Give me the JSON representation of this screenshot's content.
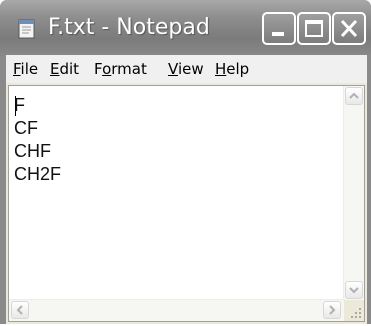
{
  "window": {
    "title": "F.txt - Notepad",
    "icon": "notepad-icon",
    "controls": {
      "minimize_icon": "minimize-icon",
      "maximize_icon": "maximize-icon",
      "close_icon": "close-icon"
    }
  },
  "menu": {
    "items": [
      {
        "mnemonic": "F",
        "rest": "ile"
      },
      {
        "mnemonic": "E",
        "rest": "dit"
      },
      {
        "pre": "F",
        "mnemonic": "o",
        "rest": "rmat"
      },
      {
        "mnemonic": "V",
        "rest": "iew"
      },
      {
        "mnemonic": "H",
        "rest": "elp"
      }
    ]
  },
  "document": {
    "lines": [
      "F",
      "CF",
      "CHF",
      "CH2F"
    ]
  },
  "scrollbars": {
    "up_icon": "scroll-up-icon",
    "down_icon": "scroll-down-icon",
    "left_icon": "scroll-left-icon",
    "right_icon": "scroll-right-icon",
    "grip_icon": "resize-grip-icon"
  },
  "colors": {
    "titlebar": "#8f8f8f",
    "menubar": "#f0f0f0",
    "editor_bg": "#ffffff"
  }
}
